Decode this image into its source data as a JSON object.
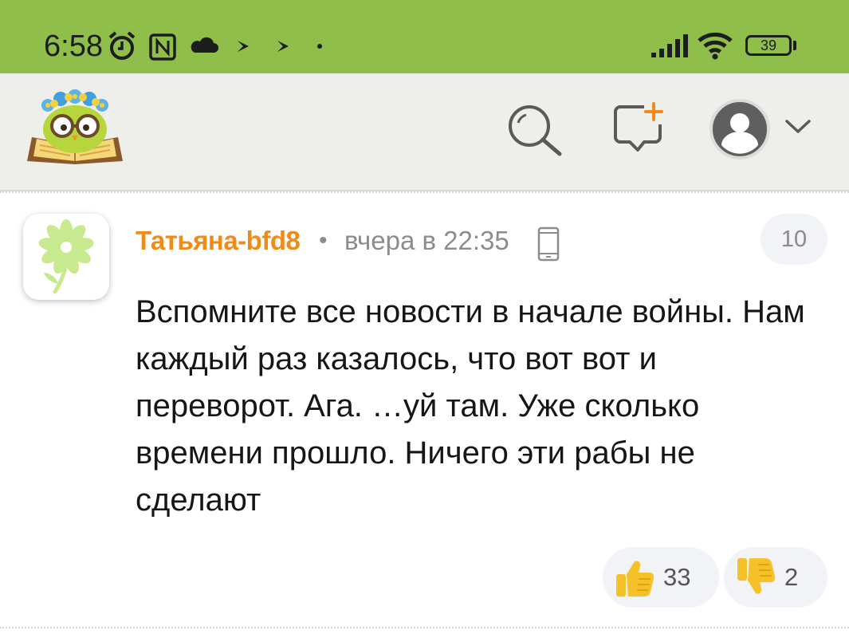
{
  "status_bar": {
    "time": "6:58",
    "left_icons": [
      "alarm-icon",
      "nfc-icon",
      "cloud-icon",
      "play-icon",
      "play-icon",
      "dot-icon"
    ],
    "right_icons": [
      "signal-icon",
      "wifi-icon",
      "battery-icon"
    ],
    "battery": "39",
    "bg_color": "#8fbf4a"
  },
  "header": {
    "logo": "owl-on-book-logo",
    "actions": [
      "search-icon",
      "new-message-icon",
      "account-avatar-icon",
      "chevron-down-icon"
    ],
    "bg_color": "#eeeeea"
  },
  "comment": {
    "avatar": "flower-avatar",
    "author": "Татьяна-bfd8",
    "separator": "•",
    "timestamp": "вчера в 22:35",
    "device_icon": "mobile-phone-icon",
    "count": "10",
    "text": "Вспомните все новости в начале войны. Нам каждый раз казалось, что вот вот и переворот. Ага. …уй там. Уже сколько времени прошло. Ничего эти рабы не сделают",
    "likes": "33",
    "dislikes": "2",
    "author_color": "#ef8b16"
  }
}
